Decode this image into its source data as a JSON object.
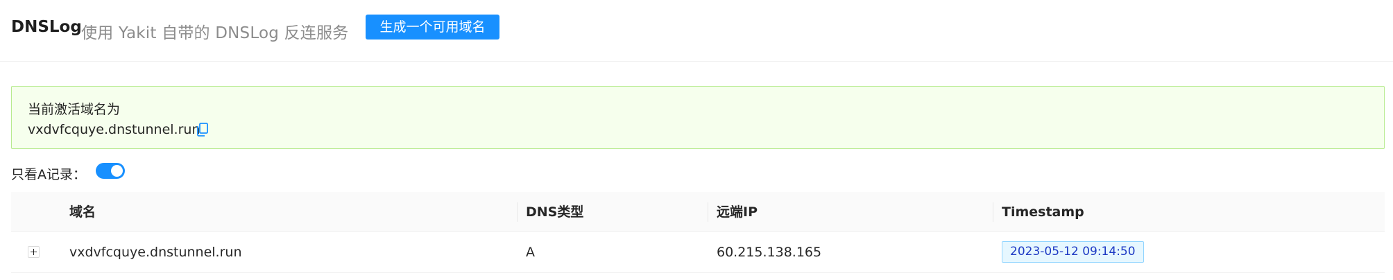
{
  "header": {
    "title": "DNSLog",
    "subtitle": "使用 Yakit 自带的 DNSLog 反连服务",
    "generate_button_label": "生成一个可用域名"
  },
  "alert": {
    "title": "当前激活域名为",
    "domain": "vxdvfcquye.dnstunnel.run",
    "copy_icon": "copy-icon",
    "status_colors": {
      "background": "#f6ffed",
      "border": "#b7eb8f"
    }
  },
  "filter": {
    "label": "只看A记录：",
    "only_a_records": true
  },
  "table": {
    "columns": [
      "域名",
      "DNS类型",
      "远端IP",
      "Timestamp"
    ],
    "rows": [
      {
        "domain": "vxdvfcquye.dnstunnel.run",
        "dns_type": "A",
        "remote_ip": "60.215.138.165",
        "timestamp": "2023-05-12 09:14:50",
        "expanded": false
      }
    ]
  },
  "colors": {
    "accent": "#1890ff",
    "tag_bg": "#e6f7ff",
    "tag_border": "#91d5ff",
    "tag_text": "#1d39c4"
  }
}
